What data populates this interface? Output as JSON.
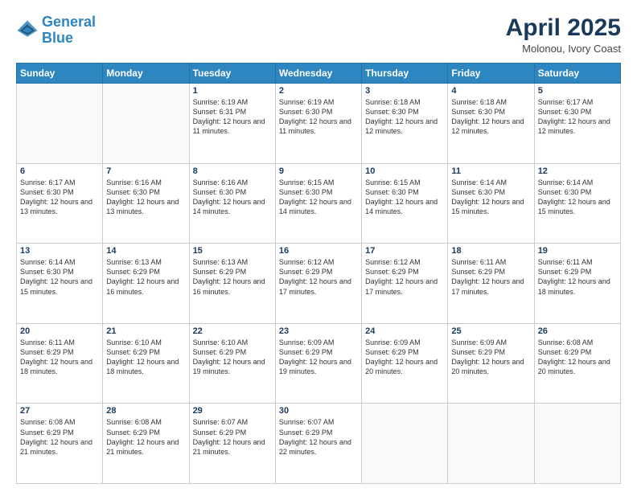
{
  "logo": {
    "line1": "General",
    "line2": "Blue"
  },
  "title": "April 2025",
  "location": "Molonou, Ivory Coast",
  "days_of_week": [
    "Sunday",
    "Monday",
    "Tuesday",
    "Wednesday",
    "Thursday",
    "Friday",
    "Saturday"
  ],
  "weeks": [
    [
      {
        "num": "",
        "info": ""
      },
      {
        "num": "",
        "info": ""
      },
      {
        "num": "1",
        "info": "Sunrise: 6:19 AM\nSunset: 6:31 PM\nDaylight: 12 hours and 11 minutes."
      },
      {
        "num": "2",
        "info": "Sunrise: 6:19 AM\nSunset: 6:30 PM\nDaylight: 12 hours and 11 minutes."
      },
      {
        "num": "3",
        "info": "Sunrise: 6:18 AM\nSunset: 6:30 PM\nDaylight: 12 hours and 12 minutes."
      },
      {
        "num": "4",
        "info": "Sunrise: 6:18 AM\nSunset: 6:30 PM\nDaylight: 12 hours and 12 minutes."
      },
      {
        "num": "5",
        "info": "Sunrise: 6:17 AM\nSunset: 6:30 PM\nDaylight: 12 hours and 12 minutes."
      }
    ],
    [
      {
        "num": "6",
        "info": "Sunrise: 6:17 AM\nSunset: 6:30 PM\nDaylight: 12 hours and 13 minutes."
      },
      {
        "num": "7",
        "info": "Sunrise: 6:16 AM\nSunset: 6:30 PM\nDaylight: 12 hours and 13 minutes."
      },
      {
        "num": "8",
        "info": "Sunrise: 6:16 AM\nSunset: 6:30 PM\nDaylight: 12 hours and 14 minutes."
      },
      {
        "num": "9",
        "info": "Sunrise: 6:15 AM\nSunset: 6:30 PM\nDaylight: 12 hours and 14 minutes."
      },
      {
        "num": "10",
        "info": "Sunrise: 6:15 AM\nSunset: 6:30 PM\nDaylight: 12 hours and 14 minutes."
      },
      {
        "num": "11",
        "info": "Sunrise: 6:14 AM\nSunset: 6:30 PM\nDaylight: 12 hours and 15 minutes."
      },
      {
        "num": "12",
        "info": "Sunrise: 6:14 AM\nSunset: 6:30 PM\nDaylight: 12 hours and 15 minutes."
      }
    ],
    [
      {
        "num": "13",
        "info": "Sunrise: 6:14 AM\nSunset: 6:30 PM\nDaylight: 12 hours and 15 minutes."
      },
      {
        "num": "14",
        "info": "Sunrise: 6:13 AM\nSunset: 6:29 PM\nDaylight: 12 hours and 16 minutes."
      },
      {
        "num": "15",
        "info": "Sunrise: 6:13 AM\nSunset: 6:29 PM\nDaylight: 12 hours and 16 minutes."
      },
      {
        "num": "16",
        "info": "Sunrise: 6:12 AM\nSunset: 6:29 PM\nDaylight: 12 hours and 17 minutes."
      },
      {
        "num": "17",
        "info": "Sunrise: 6:12 AM\nSunset: 6:29 PM\nDaylight: 12 hours and 17 minutes."
      },
      {
        "num": "18",
        "info": "Sunrise: 6:11 AM\nSunset: 6:29 PM\nDaylight: 12 hours and 17 minutes."
      },
      {
        "num": "19",
        "info": "Sunrise: 6:11 AM\nSunset: 6:29 PM\nDaylight: 12 hours and 18 minutes."
      }
    ],
    [
      {
        "num": "20",
        "info": "Sunrise: 6:11 AM\nSunset: 6:29 PM\nDaylight: 12 hours and 18 minutes."
      },
      {
        "num": "21",
        "info": "Sunrise: 6:10 AM\nSunset: 6:29 PM\nDaylight: 12 hours and 18 minutes."
      },
      {
        "num": "22",
        "info": "Sunrise: 6:10 AM\nSunset: 6:29 PM\nDaylight: 12 hours and 19 minutes."
      },
      {
        "num": "23",
        "info": "Sunrise: 6:09 AM\nSunset: 6:29 PM\nDaylight: 12 hours and 19 minutes."
      },
      {
        "num": "24",
        "info": "Sunrise: 6:09 AM\nSunset: 6:29 PM\nDaylight: 12 hours and 20 minutes."
      },
      {
        "num": "25",
        "info": "Sunrise: 6:09 AM\nSunset: 6:29 PM\nDaylight: 12 hours and 20 minutes."
      },
      {
        "num": "26",
        "info": "Sunrise: 6:08 AM\nSunset: 6:29 PM\nDaylight: 12 hours and 20 minutes."
      }
    ],
    [
      {
        "num": "27",
        "info": "Sunrise: 6:08 AM\nSunset: 6:29 PM\nDaylight: 12 hours and 21 minutes."
      },
      {
        "num": "28",
        "info": "Sunrise: 6:08 AM\nSunset: 6:29 PM\nDaylight: 12 hours and 21 minutes."
      },
      {
        "num": "29",
        "info": "Sunrise: 6:07 AM\nSunset: 6:29 PM\nDaylight: 12 hours and 21 minutes."
      },
      {
        "num": "30",
        "info": "Sunrise: 6:07 AM\nSunset: 6:29 PM\nDaylight: 12 hours and 22 minutes."
      },
      {
        "num": "",
        "info": ""
      },
      {
        "num": "",
        "info": ""
      },
      {
        "num": "",
        "info": ""
      }
    ]
  ]
}
